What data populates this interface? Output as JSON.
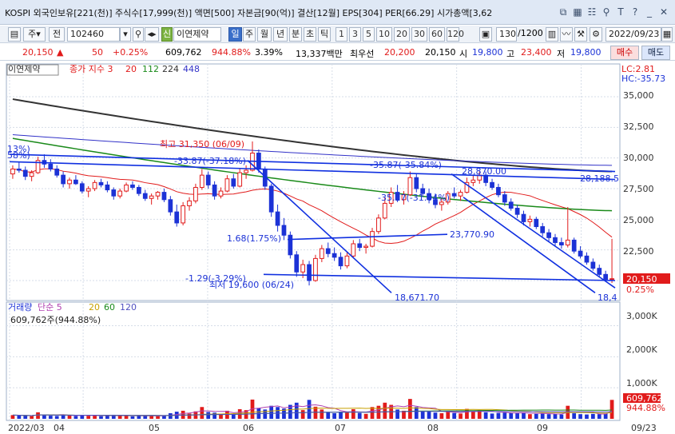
{
  "window": {
    "title": "KOSPI 외국인보유[221(천)] 주식수[17,999(천)] 액면[500] 자본금[90(억)] 결산[12월] EPS[304] PER[66.29] 시가총액[3,62"
  },
  "toolbar": {
    "code_type": "주",
    "market": "전",
    "code": "102460",
    "stock_name": "이연제약",
    "period_on": "일",
    "periods": [
      "주",
      "월",
      "년",
      "분",
      "초",
      "틱"
    ],
    "ranges": [
      "1",
      "3",
      "5",
      "10",
      "20",
      "30",
      "60",
      "120"
    ],
    "count": "130",
    "count_total": "/1200",
    "date": "2022/09/23"
  },
  "quote": {
    "price": "20,150",
    "change": "50",
    "change_pct": "+0.25%",
    "volume": "609,762",
    "volume_ratio": "944.88%",
    "turnover": "3.39%",
    "amount": "13,337백만",
    "best_label": "최우선",
    "best_ask": "20,200",
    "best_bid": "20,150",
    "open_label": "시",
    "open": "19,800",
    "high_label": "고",
    "high": "23,400",
    "low_label": "저",
    "low": "19,800",
    "buy": "매수",
    "sell": "매도"
  },
  "colors": {
    "up": "#e11b1b",
    "down": "#1c32d6",
    "ma5": "#e11b1b",
    "ma20": "#e11b1b",
    "ma112": "#1a8a1a",
    "ma224": "#333333",
    "ma448": "#3232c8",
    "trend": "#1030e0",
    "vol_ma5": "#b040b0",
    "vol_ma20": "#c8a000",
    "vol_ma60": "#1a8a1a",
    "vol_ma120": "#5050c0"
  },
  "price_panel": {
    "name": "이연제약",
    "legend": [
      {
        "label": "종가 지수 3",
        "color": "#e11b1b"
      },
      {
        "label": "20",
        "color": "#e11b1b"
      },
      {
        "label": "112",
        "color": "#1a8a1a"
      },
      {
        "label": "224",
        "color": "#333333"
      },
      {
        "label": "448",
        "color": "#3232c8"
      }
    ],
    "lc": "LC:2.81",
    "hc": "HC:-35.73",
    "y_ticks": [
      "35,000",
      "32,500",
      "30,000",
      "27,500",
      "25,000",
      "22,500"
    ],
    "current_price": "20,150",
    "current_pct": "0.25%",
    "annotations": {
      "high": "최고 31,350 (06/09)",
      "low": "최저 19,600 (06/24)",
      "a1": "-33.87(-37.18%)",
      "a2": "-35.87(-35.84%)",
      "a3": "28,870.00",
      "a4": "28,188.5",
      "a5": "-35.27(-31.04%)",
      "a6": "23,770.90",
      "a7": "1.68(1.75%)",
      "a8": "-1.29(-3.29%)",
      "a9": "18,671.70",
      "a10": "18,4",
      "a11": "13%)",
      "a12": "58%)"
    }
  },
  "volume_panel": {
    "legend": [
      {
        "label": "거래량",
        "color": "#1c32d6"
      },
      {
        "label": "단순 5",
        "color": "#b040b0"
      },
      {
        "label": "20",
        "color": "#c8a000"
      },
      {
        "label": "60",
        "color": "#1a8a1a"
      },
      {
        "label": "120",
        "color": "#5050c0"
      }
    ],
    "current": "609,762주(944.88%)",
    "y_ticks": [
      "3,000K",
      "2,000K",
      "1,000K"
    ],
    "current_value": "609,762",
    "current_pct": "944.88%"
  },
  "x_axis": {
    "labels": [
      "2022/03",
      "04",
      "05",
      "06",
      "07",
      "08",
      "09",
      "09/23"
    ]
  },
  "chart_data": {
    "type": "candlestick",
    "title": "이연제약",
    "y_range": [
      18500,
      36500
    ],
    "volume_range": [
      0,
      3400
    ],
    "months": [
      "2022/03",
      "04",
      "05",
      "06",
      "07",
      "08",
      "09"
    ],
    "candles": [
      [
        28700,
        29400,
        28300,
        29100,
        120
      ],
      [
        29100,
        29700,
        28800,
        29000,
        110
      ],
      [
        29000,
        29300,
        28200,
        28500,
        95
      ],
      [
        28500,
        29000,
        28100,
        28800,
        88
      ],
      [
        28800,
        30100,
        28700,
        29800,
        210
      ],
      [
        29800,
        30300,
        29200,
        29500,
        130
      ],
      [
        29500,
        29900,
        28900,
        29100,
        100
      ],
      [
        29100,
        29400,
        28400,
        28600,
        92
      ],
      [
        28600,
        28900,
        27600,
        27900,
        140
      ],
      [
        27900,
        28400,
        27500,
        28200,
        105
      ],
      [
        28200,
        28600,
        27800,
        27900,
        90
      ],
      [
        27900,
        28100,
        27100,
        27300,
        115
      ],
      [
        27300,
        27700,
        26800,
        27500,
        98
      ],
      [
        27500,
        28200,
        27300,
        28000,
        120
      ],
      [
        28000,
        28300,
        27600,
        27800,
        85
      ],
      [
        27800,
        28100,
        27200,
        27400,
        90
      ],
      [
        27400,
        27600,
        26600,
        26900,
        130
      ],
      [
        26900,
        27500,
        26700,
        27300,
        95
      ],
      [
        27300,
        28000,
        27200,
        27800,
        110
      ],
      [
        27800,
        28100,
        27400,
        27600,
        80
      ],
      [
        27600,
        27800,
        26900,
        27100,
        90
      ],
      [
        27100,
        27400,
        26500,
        26700,
        100
      ],
      [
        26700,
        27100,
        26200,
        26900,
        105
      ],
      [
        26900,
        27300,
        26600,
        27200,
        88
      ],
      [
        27200,
        27500,
        26400,
        26600,
        96
      ],
      [
        26600,
        26900,
        25300,
        25600,
        180
      ],
      [
        25600,
        26200,
        24400,
        24700,
        230
      ],
      [
        24700,
        26400,
        24500,
        26100,
        260
      ],
      [
        26100,
        26800,
        25700,
        26500,
        170
      ],
      [
        26500,
        27900,
        26300,
        27600,
        240
      ],
      [
        27600,
        29100,
        27400,
        28600,
        380
      ],
      [
        28600,
        28900,
        27500,
        27800,
        220
      ],
      [
        27800,
        28100,
        26600,
        26900,
        200
      ],
      [
        26900,
        27600,
        26700,
        27300,
        150
      ],
      [
        27300,
        28600,
        27200,
        28300,
        260
      ],
      [
        28300,
        28700,
        27500,
        27700,
        150
      ],
      [
        27700,
        29100,
        27600,
        28800,
        310
      ],
      [
        28800,
        29400,
        28300,
        29000,
        280
      ],
      [
        29000,
        31350,
        28900,
        30400,
        620
      ],
      [
        30400,
        30700,
        28800,
        29100,
        350
      ],
      [
        29100,
        29300,
        27400,
        27700,
        300
      ],
      [
        27700,
        27900,
        25200,
        25600,
        420
      ],
      [
        25600,
        26200,
        24000,
        24500,
        380
      ],
      [
        24500,
        25100,
        23300,
        23700,
        330
      ],
      [
        23700,
        24000,
        21800,
        22100,
        450
      ],
      [
        22100,
        22400,
        20300,
        20700,
        520
      ],
      [
        20700,
        21700,
        20200,
        21300,
        280
      ],
      [
        21300,
        21600,
        19600,
        20000,
        610
      ],
      [
        20000,
        22100,
        19900,
        21800,
        390
      ],
      [
        21800,
        22900,
        21500,
        22600,
        300
      ],
      [
        22600,
        23100,
        21900,
        22200,
        220
      ],
      [
        22200,
        22700,
        21600,
        21900,
        180
      ],
      [
        21900,
        22300,
        20900,
        21200,
        230
      ],
      [
        21200,
        22300,
        21000,
        22000,
        200
      ],
      [
        22000,
        23300,
        21900,
        23000,
        310
      ],
      [
        23000,
        23400,
        22400,
        22700,
        190
      ],
      [
        22700,
        23000,
        22200,
        22800,
        160
      ],
      [
        22800,
        24300,
        22700,
        24000,
        380
      ],
      [
        24000,
        25400,
        23800,
        25100,
        420
      ],
      [
        25100,
        26800,
        25000,
        26300,
        520
      ],
      [
        26300,
        27600,
        26000,
        27200,
        450
      ],
      [
        27200,
        27800,
        26400,
        26600,
        300
      ],
      [
        26600,
        27300,
        26200,
        27000,
        260
      ],
      [
        27000,
        28900,
        26900,
        28400,
        640
      ],
      [
        28400,
        28700,
        27200,
        27500,
        380
      ],
      [
        27500,
        27900,
        26800,
        27100,
        250
      ],
      [
        27100,
        27500,
        26300,
        26600,
        230
      ],
      [
        26600,
        27100,
        25900,
        26200,
        200
      ],
      [
        26200,
        26700,
        25700,
        26400,
        180
      ],
      [
        26400,
        27300,
        26200,
        27100,
        260
      ],
      [
        27100,
        27600,
        26700,
        26900,
        190
      ],
      [
        26900,
        27400,
        26500,
        27200,
        170
      ],
      [
        27200,
        28400,
        27100,
        28000,
        320
      ],
      [
        28000,
        28600,
        27700,
        28200,
        240
      ],
      [
        28200,
        28900,
        27900,
        28600,
        280
      ],
      [
        28600,
        28900,
        27700,
        28000,
        210
      ],
      [
        28000,
        28300,
        27400,
        27600,
        170
      ],
      [
        27600,
        27900,
        26800,
        27000,
        190
      ],
      [
        27000,
        27300,
        26100,
        26400,
        200
      ],
      [
        26400,
        26700,
        25700,
        25900,
        180
      ],
      [
        25900,
        26200,
        25100,
        25400,
        190
      ],
      [
        25400,
        25700,
        24500,
        24800,
        200
      ],
      [
        24800,
        25300,
        24400,
        25000,
        150
      ],
      [
        25000,
        25200,
        24200,
        24400,
        160
      ],
      [
        24400,
        24700,
        23600,
        23900,
        170
      ],
      [
        23900,
        24200,
        23200,
        23500,
        150
      ],
      [
        23500,
        23800,
        22800,
        23100,
        160
      ],
      [
        23100,
        23500,
        22600,
        22900,
        140
      ],
      [
        22900,
        26000,
        22700,
        23300,
        420
      ],
      [
        23300,
        23500,
        22200,
        22400,
        180
      ],
      [
        22400,
        22800,
        21800,
        22000,
        150
      ],
      [
        22000,
        22300,
        21300,
        21500,
        140
      ],
      [
        21500,
        21800,
        20800,
        21000,
        160
      ],
      [
        21000,
        21300,
        20300,
        20500,
        150
      ],
      [
        20500,
        20800,
        19900,
        20100,
        170
      ],
      [
        20100,
        23400,
        19800,
        20150,
        610
      ]
    ]
  }
}
